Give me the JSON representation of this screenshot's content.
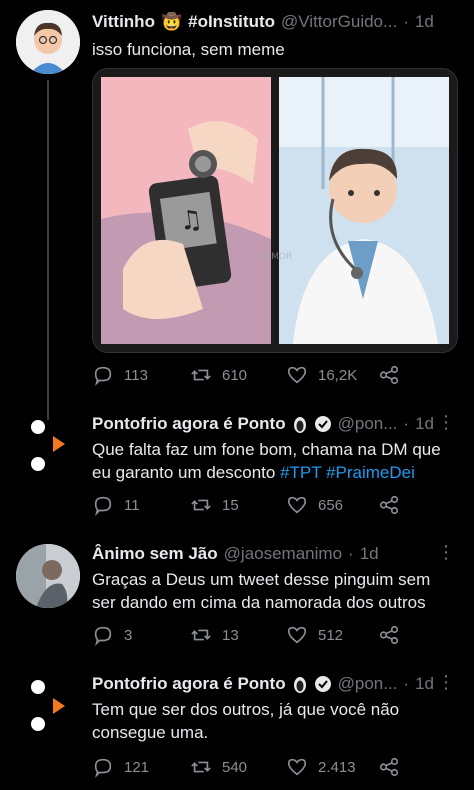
{
  "tweets": [
    {
      "name": "Vittinho",
      "name_extra": "#oInstituto",
      "handle": "@VittorGuido...",
      "time": "1d",
      "text": "isso funciona, sem meme",
      "actions": {
        "replies": "113",
        "retweets": "610",
        "likes": "16,2K"
      }
    },
    {
      "name": "Pontofrio agora é Ponto",
      "handle": "@pon...",
      "time": "1d",
      "text_parts": [
        "Que falta faz um fone bom, chama na DM que eu garanto um desconto ",
        "#TPT",
        " ",
        "#PraimeDei"
      ],
      "actions": {
        "replies": "11",
        "retweets": "15",
        "likes": "656"
      }
    },
    {
      "name": "Ânimo sem Jão",
      "handle": "@jaosemanimo",
      "time": "1d",
      "text": "Graças a Deus um tweet desse pinguim sem ser dando em cima da namorada dos outros",
      "actions": {
        "replies": "3",
        "retweets": "13",
        "likes": "512"
      }
    },
    {
      "name": "Pontofrio agora é Ponto",
      "handle": "@pon...",
      "time": "1d",
      "text": "Tem que ser dos outros, já que você não consegue uma.",
      "actions": {
        "replies": "121",
        "retweets": "540",
        "likes": "2.413"
      }
    }
  ],
  "colors": {
    "accent": "#1d9bf0",
    "brand_orange": "#f47a20",
    "muted": "#71767b"
  }
}
